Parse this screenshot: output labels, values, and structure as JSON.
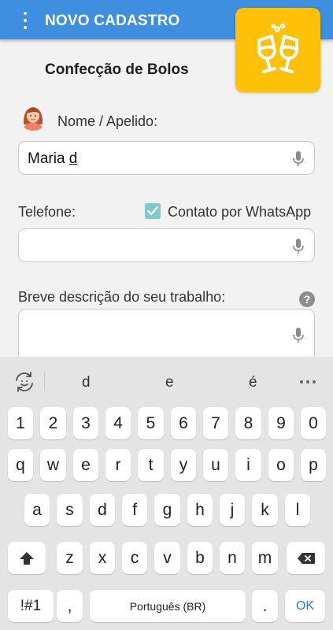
{
  "header": {
    "title": "NOVO CADASTRO",
    "menu_icon": "more-vertical-icon",
    "badge_icon": "toast-glasses-icon",
    "color": "#3e8fe0",
    "badge_color": "#ffc107"
  },
  "form": {
    "category": "Confecção de Bolos",
    "name_label": "Nome / Apelido:",
    "name_value_prefix": "Maria ",
    "name_value_composing": "d",
    "phone_label": "Telefone:",
    "whatsapp_label": "Contato por WhatsApp",
    "whatsapp_checked": true,
    "phone_value": "",
    "description_label": "Breve descrição do seu trabalho:",
    "help_glyph": "?",
    "description_value": ""
  },
  "keyboard": {
    "suggestions": [
      "d",
      "e",
      "é"
    ],
    "number_row": [
      "1",
      "2",
      "3",
      "4",
      "5",
      "6",
      "7",
      "8",
      "9",
      "0"
    ],
    "row1": [
      "q",
      "w",
      "e",
      "r",
      "t",
      "y",
      "u",
      "i",
      "o",
      "p"
    ],
    "row2": [
      "a",
      "s",
      "d",
      "f",
      "g",
      "h",
      "j",
      "k",
      "l"
    ],
    "row3": [
      "z",
      "x",
      "c",
      "v",
      "b",
      "n",
      "m"
    ],
    "symbols_key": "!#1",
    "comma_key": ",",
    "space_label": "Português (BR)",
    "period_key": ".",
    "enter_label": "OK"
  }
}
